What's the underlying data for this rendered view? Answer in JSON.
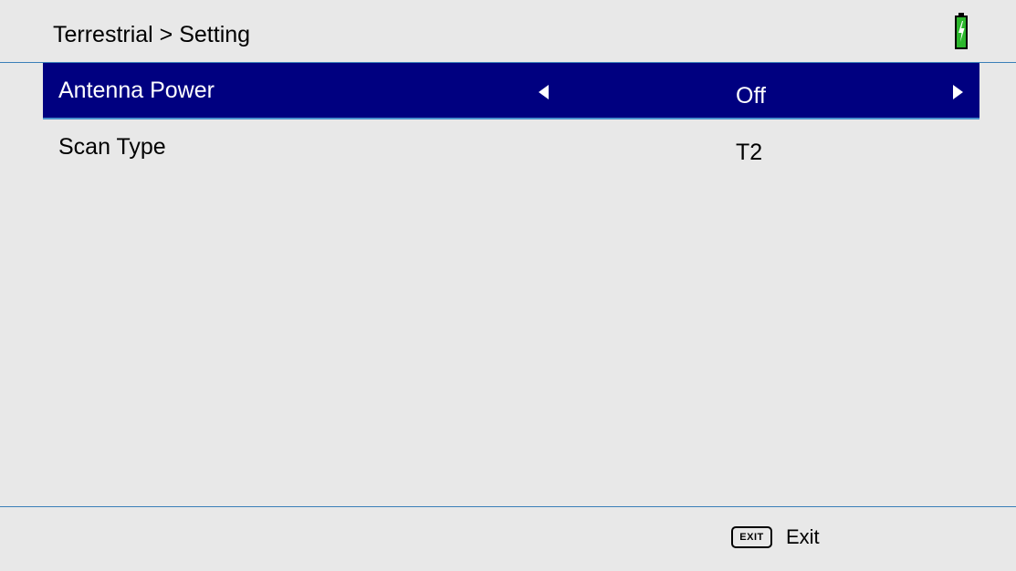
{
  "header": {
    "breadcrumb": "Terrestrial > Setting",
    "battery_icon": "battery-charging-icon",
    "battery_color": "#2db82d"
  },
  "settings": [
    {
      "label": "Antenna Power",
      "value": "Off",
      "selected": true
    },
    {
      "label": "Scan Type",
      "value": "T2",
      "selected": false
    }
  ],
  "footer": {
    "exit_key": "EXIT",
    "exit_label": "Exit"
  },
  "colors": {
    "background": "#e8e8e8",
    "selected_row": "#000080",
    "divider": "#3a7fb8"
  }
}
